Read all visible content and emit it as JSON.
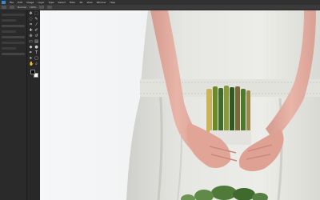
{
  "app": {
    "name": "Photoshop"
  },
  "menu": [
    "File",
    "Edit",
    "Image",
    "Layer",
    "Type",
    "Select",
    "Filter",
    "3D",
    "View",
    "Window",
    "Help"
  ],
  "options": {
    "mode": "Normal",
    "opacity": "100%"
  },
  "colors": {
    "foreground": "#000000",
    "background": "#ffffff",
    "accent": "#2f8ad8"
  },
  "tools": [
    "move-icon",
    "marquee-icon",
    "lasso-icon",
    "quick-select-icon",
    "crop-icon",
    "eyedropper-icon",
    "healing-icon",
    "brush-icon",
    "clone-icon",
    "history-brush-icon",
    "eraser-icon",
    "gradient-icon",
    "blur-icon",
    "dodge-icon",
    "pen-icon",
    "type-icon",
    "path-select-icon",
    "shape-icon",
    "hand-icon",
    "zoom-icon"
  ]
}
